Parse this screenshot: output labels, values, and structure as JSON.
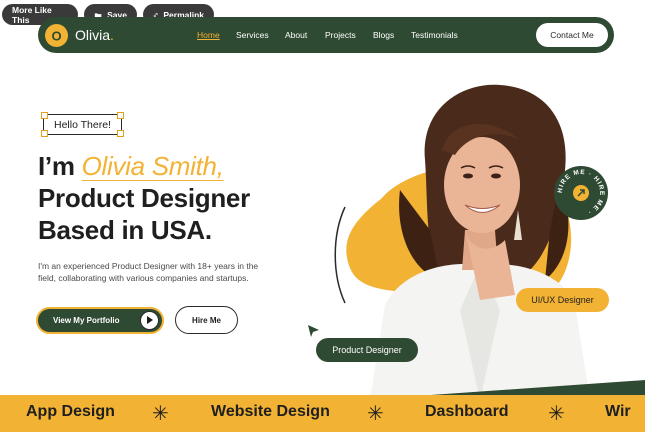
{
  "overlay": {
    "more_like_this": "More Like This",
    "save": "Save",
    "permalink": "Permalink"
  },
  "nav": {
    "logo_letter": "O",
    "logo_text": "Olivia",
    "links": [
      "Home",
      "Services",
      "About",
      "Projects",
      "Blogs",
      "Testimonials"
    ],
    "active": "Home",
    "contact": "Contact Me"
  },
  "hero": {
    "greeting": "Hello There!",
    "line1_prefix": "I’m ",
    "name": "Olivia Smith,",
    "line2": "Product Designer",
    "line3": "Based in USA.",
    "description": "I'm an experienced Product Designer with 18+ years in the field, collaborating with various companies and startups.",
    "portfolio_btn": "View My Portfolio",
    "hire_btn": "Hire Me",
    "badge_ui": "UI/UX Designer",
    "badge_pd": "Product Designer",
    "hire_circle": "HIRE ME · HIRE ME ·"
  },
  "marquee": {
    "items": [
      "App Design",
      "Website Design",
      "Dashboard",
      "Wir"
    ]
  },
  "colors": {
    "accent": "#f2b233",
    "dark_green": "#2f4a33",
    "text": "#1f1f1f"
  }
}
